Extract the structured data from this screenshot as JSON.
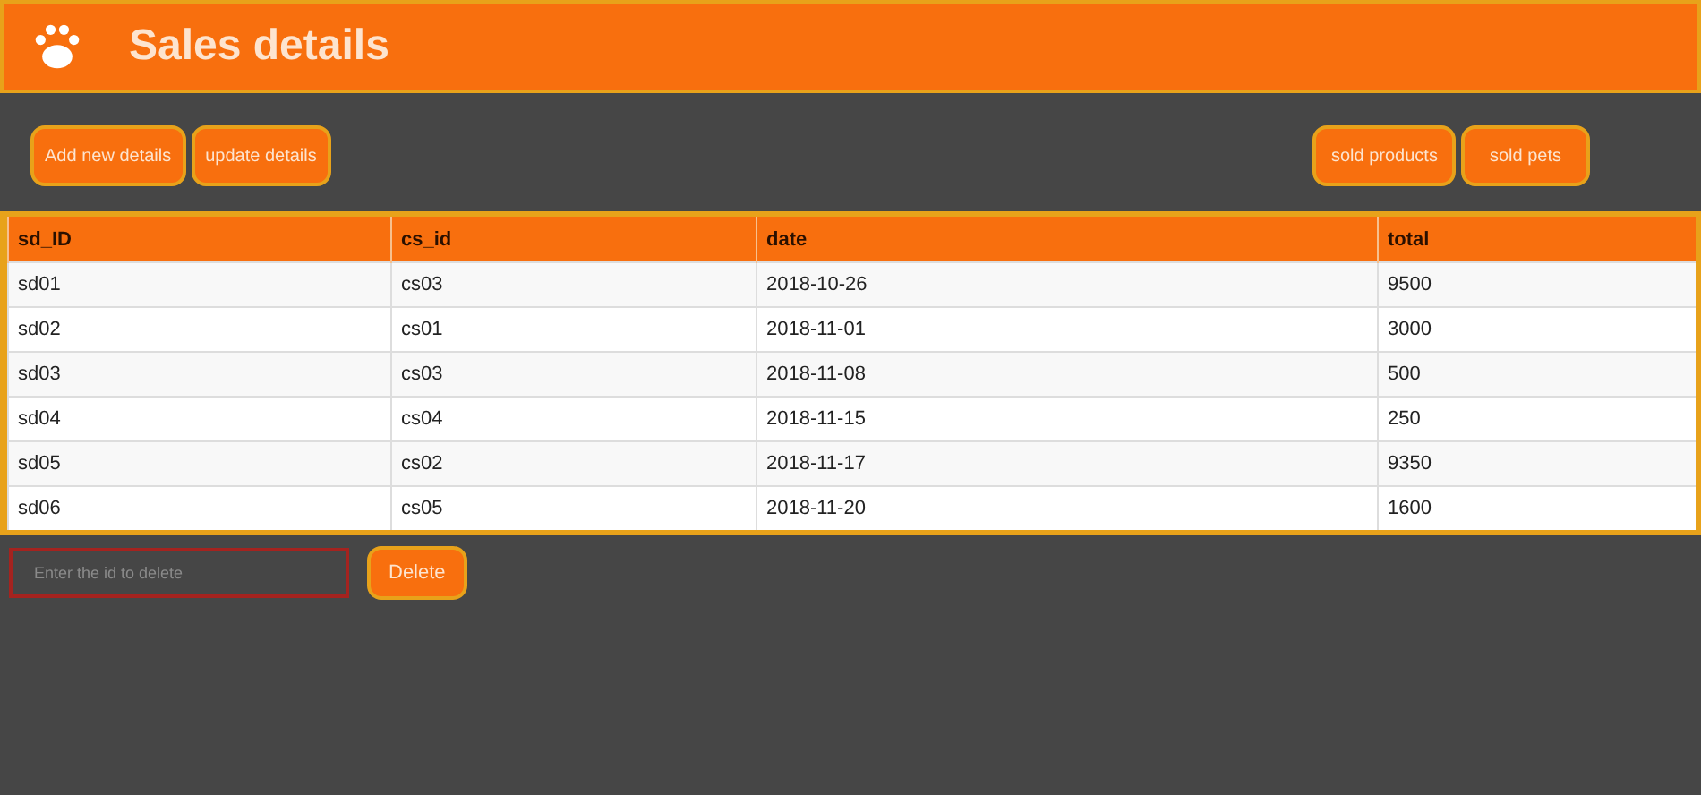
{
  "header": {
    "title": "Sales details"
  },
  "toolbar": {
    "left_buttons": [
      "Add new details",
      "update details"
    ],
    "right_buttons": [
      "sold products",
      "sold pets"
    ]
  },
  "table": {
    "columns": [
      "sd_ID",
      "cs_id",
      "date",
      "total"
    ],
    "rows": [
      [
        "sd01",
        "cs03",
        "2018-10-26",
        "9500"
      ],
      [
        "sd02",
        "cs01",
        "2018-11-01",
        "3000"
      ],
      [
        "sd03",
        "cs03",
        "2018-11-08",
        "500"
      ],
      [
        "sd04",
        "cs04",
        "2018-11-15",
        "250"
      ],
      [
        "sd05",
        "cs02",
        "2018-11-17",
        "9350"
      ],
      [
        "sd06",
        "cs05",
        "2018-11-20",
        "1600"
      ]
    ]
  },
  "delete_form": {
    "placeholder": "Enter the id to delete",
    "button": "Delete"
  }
}
